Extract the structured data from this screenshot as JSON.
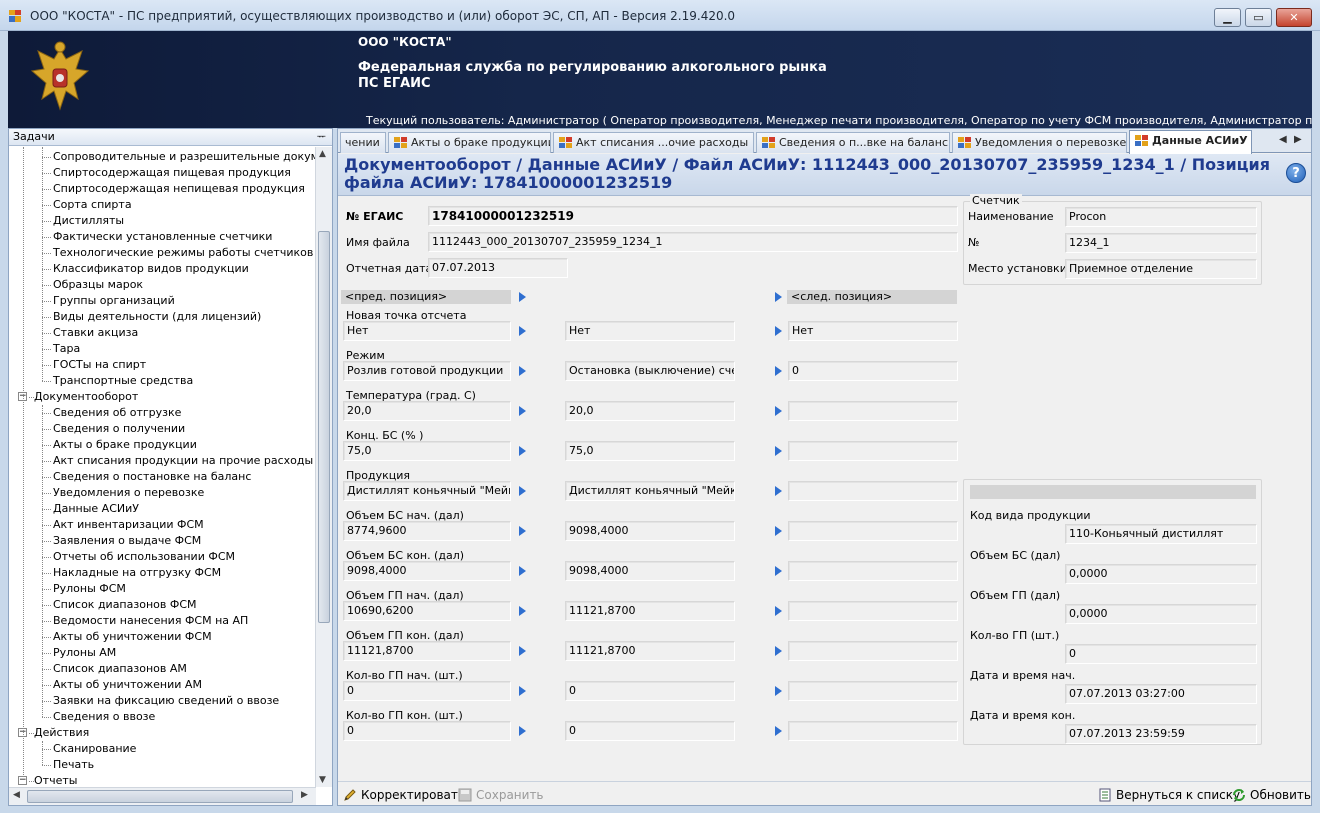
{
  "window": {
    "title": "ООО \"КОСТА\" - ПС предприятий, осуществляющих производство и (или) оборот ЭС, СП, АП - Версия 2.19.420.0",
    "min_label": "▁",
    "max_label": "▭",
    "close_label": "✕"
  },
  "banner": {
    "org": "ООО \"КОСТА\"",
    "agency": "Федеральная служба по регулированию алкогольного рынка",
    "system": "ПС ЕГАИС",
    "current_user": "Текущий пользователь: Администратор ( Оператор производителя, Менеджер печати производителя, Оператор по учету ФСМ производителя, Администратор производителя, Опера..."
  },
  "left_panel": {
    "title": "Задачи",
    "pin": "ᅲ",
    "items": [
      {
        "label": "Сопроводительные и разрешительные документы",
        "level": 2
      },
      {
        "label": "Спиртосодержащая пищевая продукция",
        "level": 2
      },
      {
        "label": "Спиртосодержащая непищевая продукция",
        "level": 2
      },
      {
        "label": "Сорта спирта",
        "level": 2
      },
      {
        "label": "Дистилляты",
        "level": 2
      },
      {
        "label": "Фактически установленные счетчики",
        "level": 2
      },
      {
        "label": "Технологические режимы работы счетчиков",
        "level": 2
      },
      {
        "label": "Классификатор видов продукции",
        "level": 2
      },
      {
        "label": "Образцы марок",
        "level": 2
      },
      {
        "label": "Группы организаций",
        "level": 2
      },
      {
        "label": "Виды деятельности (для лицензий)",
        "level": 2
      },
      {
        "label": "Ставки акциза",
        "level": 2
      },
      {
        "label": "Тара",
        "level": 2
      },
      {
        "label": "ГОСТы на спирт",
        "level": 2
      },
      {
        "label": "Транспортные средства",
        "level": 2
      },
      {
        "label": "Документооборот",
        "level": 1
      },
      {
        "label": "Сведения об отгрузке",
        "level": 2
      },
      {
        "label": "Сведения о получении",
        "level": 2
      },
      {
        "label": "Акты о браке продукции",
        "level": 2
      },
      {
        "label": "Акт списания продукции на прочие расходы",
        "level": 2
      },
      {
        "label": "Сведения о постановке на баланс",
        "level": 2
      },
      {
        "label": "Уведомления о перевозке",
        "level": 2
      },
      {
        "label": "Данные АСИиУ",
        "level": 2
      },
      {
        "label": "Акт инвентаризации ФСМ",
        "level": 2
      },
      {
        "label": "Заявления о выдаче ФСМ",
        "level": 2
      },
      {
        "label": "Отчеты об использовании ФСМ",
        "level": 2
      },
      {
        "label": "Накладные на отгрузку ФСМ",
        "level": 2
      },
      {
        "label": "Рулоны ФСМ",
        "level": 2
      },
      {
        "label": "Список диапазонов ФСМ",
        "level": 2
      },
      {
        "label": "Ведомости нанесения ФСМ на АП",
        "level": 2
      },
      {
        "label": "Акты об уничтожении ФСМ",
        "level": 2
      },
      {
        "label": "Рулоны АМ",
        "level": 2
      },
      {
        "label": "Список диапазонов АМ",
        "level": 2
      },
      {
        "label": "Акты об уничтожении АМ",
        "level": 2
      },
      {
        "label": "Заявки на фиксацию сведений о ввозе",
        "level": 2
      },
      {
        "label": "Сведения о ввозе",
        "level": 2
      },
      {
        "label": "Действия",
        "level": 1
      },
      {
        "label": "Сканирование",
        "level": 2
      },
      {
        "label": "Печать",
        "level": 2
      },
      {
        "label": "Отчеты",
        "level": 1
      }
    ]
  },
  "tabs": [
    {
      "label": "чении",
      "active": false,
      "icon": false
    },
    {
      "label": "Акты о браке продукции",
      "active": false,
      "icon": true
    },
    {
      "label": "Акт списания ...очие расходы",
      "active": false,
      "icon": true
    },
    {
      "label": "Сведения о п...вке на баланс",
      "active": false,
      "icon": true
    },
    {
      "label": "Уведомления о перевозке",
      "active": false,
      "icon": true
    },
    {
      "label": "Данные АСИиУ",
      "active": true,
      "icon": true
    }
  ],
  "doc": {
    "breadcrumb": "Документооборот / Данные АСИиУ / Файл АСИиУ: 1112443_000_20130707_235959_1234_1 / Позиция файла АСИиУ: 17841000001232519",
    "help": "?",
    "egais_label": "№ ЕГАИС",
    "egais_value": "17841000001232519",
    "file_label": "Имя файла",
    "file_value": "1112443_000_20130707_235959_1234_1",
    "date_label": "Отчетная дата",
    "date_value": "07.07.2013",
    "counter": {
      "caption": "Счетчик",
      "name_label": "Наименование",
      "name_value": "Procon",
      "num_label": "№",
      "num_value": "1234_1",
      "place_label": "Место установки",
      "place_value": "Приемное отделение"
    },
    "prev_pos": "<пред. позиция>",
    "next_pos": "<след. позиция>",
    "rows": [
      {
        "label": "Новая точка отсчета",
        "prev": "Нет",
        "cur": "Нет",
        "next": "Нет"
      },
      {
        "label": "Режим",
        "prev": "Розлив готовой продукции",
        "cur": "Остановка (выключение) счетчика",
        "next": "0"
      },
      {
        "label": "Температура (град. С)",
        "prev": "20,0",
        "cur": "20,0",
        "next": ""
      },
      {
        "label": "Конц.  БС (% )",
        "prev": "75,0",
        "cur": "75,0",
        "next": ""
      },
      {
        "label": "Продукция",
        "prev": "Дистиллят коньячный \"Мейков\"",
        "cur": "Дистиллят коньячный \"Мейков\"",
        "next": ""
      },
      {
        "label": "Объем БС нач. (дал)",
        "prev": "8774,9600",
        "cur": "9098,4000",
        "next": ""
      },
      {
        "label": "Объем БС кон. (дал)",
        "prev": "9098,4000",
        "cur": "9098,4000",
        "next": ""
      },
      {
        "label": "Объем ГП нач. (дал)",
        "prev": "10690,6200",
        "cur": "11121,8700",
        "next": ""
      },
      {
        "label": "Объем ГП кон. (дал)",
        "prev": "11121,8700",
        "cur": "11121,8700",
        "next": ""
      },
      {
        "label": "Кол-во ГП нач. (шт.)",
        "prev": "0",
        "cur": "0",
        "next": ""
      },
      {
        "label": "Кол-во ГП кон. (шт.)",
        "prev": "0",
        "cur": "0",
        "next": ""
      }
    ],
    "product_box": {
      "kind_label": "Код вида продукции",
      "kind_value": "110-Коньячный дистиллят",
      "vol_bs_label": "Объем БС (дал)",
      "vol_bs_value": "0,0000",
      "vol_gp_label": "Объем ГП (дал)",
      "vol_gp_value": "0,0000",
      "cnt_gp_label": "Кол-во ГП (шт.)",
      "cnt_gp_value": "0",
      "start_label": "Дата и время нач.",
      "start_value": "07.07.2013 03:27:00",
      "end_label": "Дата и время кон.",
      "end_value": "07.07.2013 23:59:59"
    }
  },
  "toolbar": {
    "edit": "Корректировать",
    "save": "Сохранить",
    "back": "Вернуться к списку",
    "refresh": "Обновить"
  }
}
